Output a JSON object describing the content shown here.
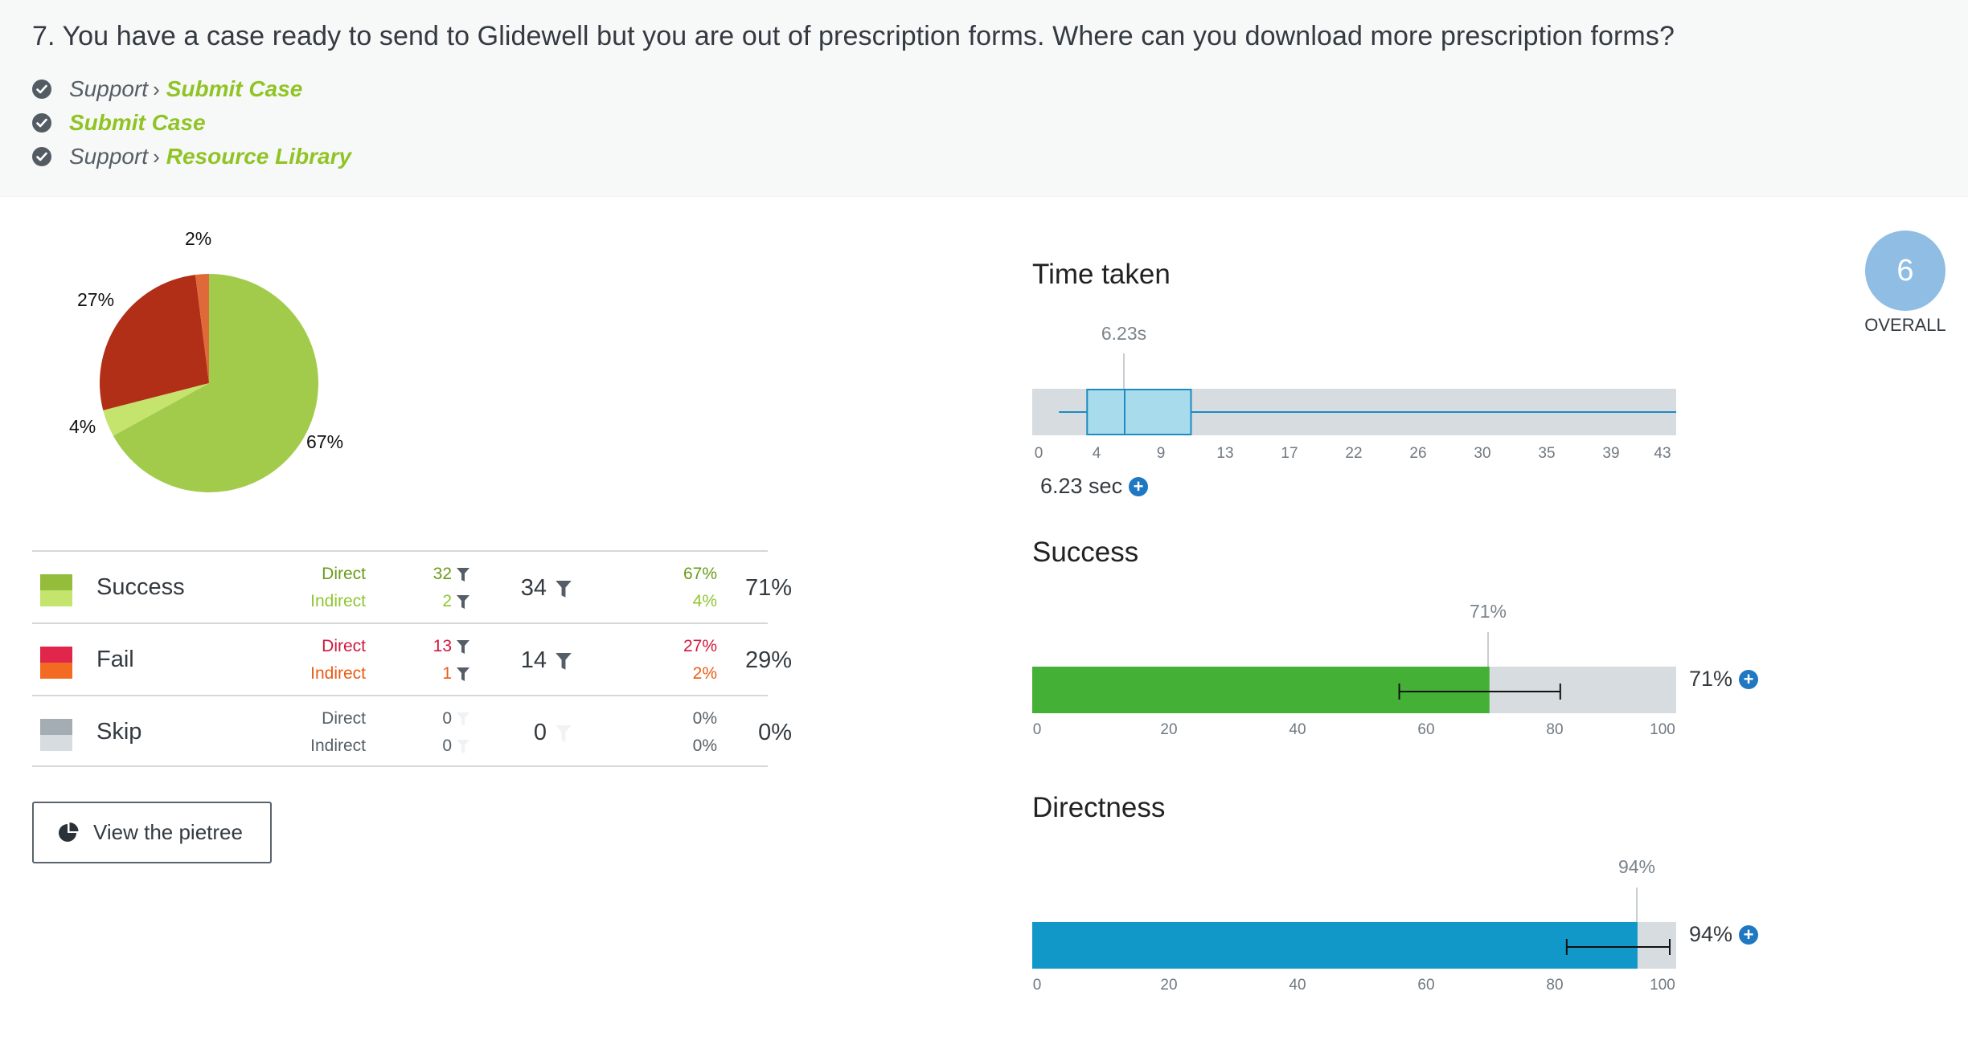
{
  "question": {
    "text": "7. You have a case ready to send to Glidewell but you are out of prescription forms. Where can you download more prescription forms?",
    "answers": [
      {
        "crumb": "Support",
        "target": "Submit Case"
      },
      {
        "crumb": "",
        "target": "Submit Case"
      },
      {
        "crumb": "Support",
        "target": "Resource Library"
      }
    ]
  },
  "colors": {
    "success_direct": "#a3cb4b",
    "success_indirect": "#c4e46e",
    "fail_direct": "#b12e17",
    "fail_indirect": "#e0693a",
    "skip_direct": "#a4adb3",
    "skip_indirect": "#d6dcdf",
    "success_bar": "#44b035",
    "directness_bar": "#1297c9",
    "accent": "#90c424"
  },
  "pie": {
    "labels": {
      "fail_indirect": "2%",
      "fail_direct": "27%",
      "success_indirect": "4%",
      "success_direct": "67%"
    },
    "slices": [
      {
        "key": "success_direct",
        "value": 67
      },
      {
        "key": "success_indirect",
        "value": 4
      },
      {
        "key": "fail_direct",
        "value": 27
      },
      {
        "key": "fail_indirect",
        "value": 2
      }
    ]
  },
  "table": {
    "rows": [
      {
        "name": "Success",
        "direct_label": "Direct",
        "indirect_label": "Indirect",
        "direct_count": "32",
        "indirect_count": "2",
        "total": "34",
        "direct_pct": "67%",
        "indirect_pct": "4%",
        "overall": "71%",
        "direct_color": "#6a9b1a",
        "indirect_color": "#8fc631",
        "sw1": "#93bd3b",
        "sw2": "#c4e46e"
      },
      {
        "name": "Fail",
        "direct_label": "Direct",
        "indirect_label": "Indirect",
        "direct_count": "13",
        "indirect_count": "1",
        "total": "14",
        "direct_pct": "27%",
        "indirect_pct": "2%",
        "overall": "29%",
        "direct_color": "#d1173d",
        "indirect_color": "#eb5b14",
        "sw1": "#e0264b",
        "sw2": "#f36a22"
      },
      {
        "name": "Skip",
        "direct_label": "Direct",
        "indirect_label": "Indirect",
        "direct_count": "0",
        "indirect_count": "0",
        "total": "0",
        "direct_pct": "0%",
        "indirect_pct": "0%",
        "overall": "0%",
        "direct_color": "#555e66",
        "indirect_color": "#555e66",
        "sw1": "#a4adb3",
        "sw2": "#d6dcdf"
      }
    ]
  },
  "buttons": {
    "pietree": "View the pietree"
  },
  "time_taken": {
    "title": "Time taken",
    "marker_label": "6.23s",
    "value_text": "6.23 sec",
    "ticks": [
      "0",
      "4",
      "9",
      "13",
      "17",
      "22",
      "26",
      "30",
      "35",
      "39",
      "43"
    ],
    "axis_max": 43.4,
    "whisker_min": 1.8,
    "q1": 3.7,
    "median": 6.23,
    "q3": 10.7,
    "whisker_max": 43.4
  },
  "success": {
    "title": "Success",
    "marker_label": "71%",
    "value_text": "71%",
    "value": 71,
    "ci_low": 57,
    "ci_high": 82,
    "ticks": [
      "0",
      "20",
      "40",
      "60",
      "80",
      "100"
    ]
  },
  "directness": {
    "title": "Directness",
    "marker_label": "94%",
    "value_text": "94%",
    "value": 94,
    "ci_low": 83,
    "ci_high": 99,
    "ticks": [
      "0",
      "20",
      "40",
      "60",
      "80",
      "100"
    ]
  },
  "overall": {
    "score": "6",
    "label": "OVERALL"
  }
}
